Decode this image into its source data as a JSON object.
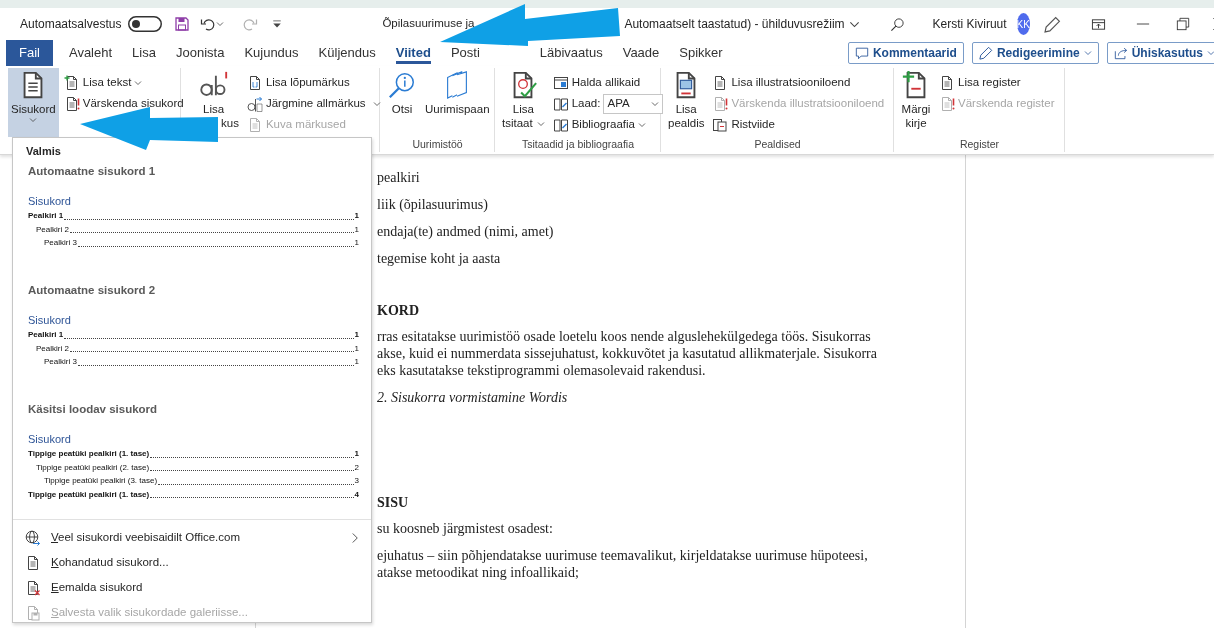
{
  "title_bar": {
    "autosave_label": "Automaatsalvestus",
    "autosave_on": false,
    "title_left": "Õpilasuurimuse ja",
    "title_right": "Automaatselt taastatud)  -  ühilduvusrežiim",
    "user_name": "Kersti Kiviruut",
    "avatar_initials": "KK"
  },
  "tabs": [
    {
      "label": "Fail",
      "kind": "file",
      "selected": false
    },
    {
      "label": "Avaleht",
      "kind": "tab",
      "selected": false
    },
    {
      "label": "Lisa",
      "kind": "tab",
      "selected": false
    },
    {
      "label": "Joonista",
      "kind": "tab",
      "selected": false
    },
    {
      "label": "Kujundus",
      "kind": "tab",
      "selected": false
    },
    {
      "label": "Küljendus",
      "kind": "tab",
      "selected": false
    },
    {
      "label": "Viited",
      "kind": "tab",
      "selected": true
    },
    {
      "label": "Posti",
      "kind": "tab",
      "selected": false
    },
    {
      "label": "Läbivaatus",
      "kind": "tab",
      "selected": false
    },
    {
      "label": "Vaade",
      "kind": "tab",
      "selected": false
    },
    {
      "label": "Spikker",
      "kind": "tab",
      "selected": false
    }
  ],
  "tab_actions": [
    {
      "label": "Kommentaarid",
      "has_menu": false
    },
    {
      "label": "Redigeerimine",
      "has_menu": true
    },
    {
      "label": "Ühiskasutus",
      "has_menu": true
    }
  ],
  "ribbon_groups": [
    {
      "controls": [
        {
          "kind": "large",
          "label_lines": [
            "Sisukord"
          ],
          "has_menu": true,
          "expanded": true,
          "disabled": false
        },
        {
          "kind": "small",
          "label": "Lisa tekst",
          "has_menu": true,
          "expanded": false,
          "disabled": false
        },
        {
          "kind": "small",
          "label": "Värskenda sisukord",
          "has_menu": false,
          "expanded": false,
          "disabled": false
        }
      ]
    },
    {
      "controls": [
        {
          "kind": "large",
          "label_lines": [
            "Lisa",
            "kus"
          ],
          "has_menu": false,
          "expanded": false,
          "disabled": false
        },
        {
          "kind": "small",
          "label": "Lisa lõpumärkus",
          "has_menu": false,
          "expanded": false,
          "disabled": false
        },
        {
          "kind": "small",
          "label": "Järgmine allmärkus",
          "has_menu": true,
          "expanded": false,
          "disabled": false
        },
        {
          "kind": "small",
          "label": "Kuva märkused",
          "has_menu": false,
          "expanded": false,
          "disabled": true
        }
      ]
    },
    {
      "label": "Uurimistöö",
      "controls": [
        {
          "kind": "large",
          "label_lines": [
            "Otsi"
          ],
          "has_menu": false,
          "expanded": false,
          "disabled": false
        },
        {
          "kind": "large",
          "label_lines": [
            "Uurimispaan"
          ],
          "has_menu": false,
          "expanded": false,
          "disabled": false
        }
      ]
    },
    {
      "label": "Tsitaadid ja bibliograafia",
      "controls": [
        {
          "kind": "large",
          "label_lines": [
            "Lisa",
            "tsitaat"
          ],
          "has_menu": true,
          "expanded": false,
          "disabled": false
        },
        {
          "kind": "small",
          "label": "Halda allikaid",
          "has_menu": false,
          "expanded": false,
          "disabled": false
        },
        {
          "kind": "select",
          "label": "Laad:",
          "value": "APA",
          "has_menu": true,
          "expanded": false,
          "disabled": false
        },
        {
          "kind": "small",
          "label": "Bibliograafia",
          "has_menu": true,
          "expanded": false,
          "disabled": false
        }
      ]
    },
    {
      "label": "Pealdised",
      "controls": [
        {
          "kind": "large",
          "label_lines": [
            "Lisa",
            "pealdis"
          ],
          "has_menu": false,
          "expanded": false,
          "disabled": false
        },
        {
          "kind": "small",
          "label": "Lisa illustratsiooniloend",
          "has_menu": false,
          "expanded": false,
          "disabled": false
        },
        {
          "kind": "small",
          "label": "Värskenda illustratsiooniloend",
          "has_menu": false,
          "expanded": false,
          "disabled": true
        },
        {
          "kind": "small",
          "label": "Ristviide",
          "has_menu": false,
          "expanded": false,
          "disabled": false
        }
      ]
    },
    {
      "label": "Register",
      "controls": [
        {
          "kind": "large",
          "label_lines": [
            "Märgi",
            "kirje"
          ],
          "has_menu": false,
          "expanded": false,
          "disabled": false
        },
        {
          "kind": "small",
          "label": "Lisa register",
          "has_menu": false,
          "expanded": false,
          "disabled": false
        },
        {
          "kind": "small",
          "label": "Värskenda register",
          "has_menu": false,
          "expanded": false,
          "disabled": true
        }
      ]
    }
  ],
  "document": {
    "lines": [
      {
        "kind": "body",
        "text": "pealkiri"
      },
      {
        "kind": "body",
        "text": "liik (õpilasuurimus)"
      },
      {
        "kind": "body",
        "text": "endaja(te) andmed (nimi, amet)"
      },
      {
        "kind": "body",
        "text": "tegemise koht ja aasta"
      },
      {
        "kind": "heading",
        "text": "KORD"
      },
      {
        "kind": "para",
        "text": "rras esitatakse uurimistöö osade loetelu koos nende alguslehekülgedega töös. Sisukorras"
      },
      {
        "kind": "para",
        "text": "akse, kuid ei nummerdata sissejuhatust, kokkuvõtet ja kasutatud allikmaterjale. Sisukorra"
      },
      {
        "kind": "para",
        "text": "eks kasutatakse tekstiprogrammi olemasolevaid rakendusi."
      },
      {
        "kind": "caption",
        "text": "2. Sisukorra vormistamine Wordis"
      },
      {
        "kind": "heading",
        "text": "SISU"
      },
      {
        "kind": "body",
        "text": "su koosneb järgmistest osadest:"
      },
      {
        "kind": "para",
        "text": "ejuhatus – siin põhjendatakse uurimuse teemavalikut, kirjeldatakse uurimuse hüpoteesi,"
      },
      {
        "kind": "para",
        "text": "atakse metoodikat ning infoallikaid;"
      }
    ]
  },
  "toc_menu": {
    "header": "Valmis",
    "gallery": [
      {
        "name": "Automaatne sisukord 1",
        "preview_title": "Sisukord",
        "entries": [
          {
            "text": "Pealkiri 1",
            "page": "1",
            "children": [
              {
                "text": "Pealkiri 2",
                "page": "1",
                "children": [
                  {
                    "text": "Pealkiri 3",
                    "page": "1"
                  }
                ]
              }
            ]
          }
        ]
      },
      {
        "name": "Automaatne sisukord 2",
        "preview_title": "Sisukord",
        "entries": [
          {
            "text": "Pealkiri 1",
            "page": "1",
            "children": [
              {
                "text": "Pealkiri 2",
                "page": "1",
                "children": [
                  {
                    "text": "Pealkiri 3",
                    "page": "1"
                  }
                ]
              }
            ]
          }
        ]
      },
      {
        "name": "Käsitsi loodav sisukord",
        "preview_title": "Sisukord",
        "entries": [
          {
            "text": "Tippige peatüki pealkiri (1. tase)",
            "page": "1",
            "children": [
              {
                "text": "Tippige peatüki pealkiri (2. tase)",
                "page": "2",
                "children": [
                  {
                    "text": "Tippige peatüki pealkiri (3. tase)",
                    "page": "3"
                  }
                ]
              }
            ]
          },
          {
            "text": "Tippige peatüki pealkiri (1. tase)",
            "page": "4"
          }
        ]
      }
    ],
    "commands": [
      {
        "label": "Veel sisukordi veebisaidilt Office.com",
        "has_submenu": true,
        "disabled": false
      },
      {
        "label": "Kohandatud sisukord...",
        "has_submenu": false,
        "disabled": false
      },
      {
        "label": "Eemalda sisukord",
        "has_submenu": false,
        "disabled": false
      },
      {
        "label": "Salvesta valik sisukordade galeriisse...",
        "has_submenu": false,
        "disabled": true
      }
    ]
  }
}
